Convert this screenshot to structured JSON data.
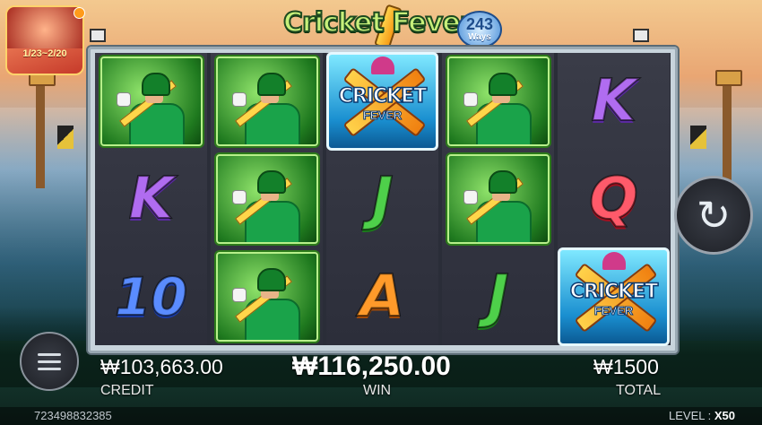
{
  "game": {
    "logo_title": "Cricket Fever",
    "ways_number": "243",
    "ways_label": "Ways"
  },
  "promo": {
    "text": "1/23~2/20"
  },
  "reels": [
    [
      "player",
      "k",
      "10"
    ],
    [
      "player",
      "player",
      "player"
    ],
    [
      "wild",
      "j",
      "a"
    ],
    [
      "player",
      "player",
      "j"
    ],
    [
      "k",
      "q",
      "wild"
    ]
  ],
  "symbols": {
    "k": "K",
    "q": "Q",
    "j": "J",
    "a": "A",
    "10": "10",
    "wild_line1": "CRICKET",
    "wild_line2": "FEVER"
  },
  "hud": {
    "credit_value": "₩103,663.00",
    "credit_label": "CREDIT",
    "win_value": "₩116,250.00",
    "win_label": "WIN",
    "total_value": "₩1500",
    "total_label": "TOTAL",
    "spin_icon": "refresh-icon",
    "menu_icon": "hamburger-menu-icon"
  },
  "footer": {
    "user_id": "723498832385",
    "level_label": "LEVEL : ",
    "level_value": "X50"
  }
}
